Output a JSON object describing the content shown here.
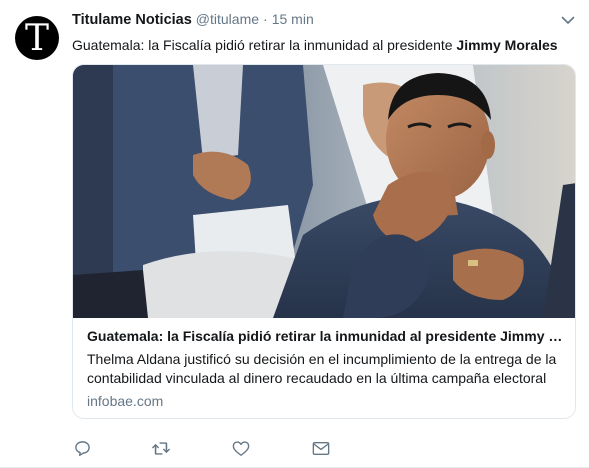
{
  "tweet": {
    "author_name": "Titulame Noticias",
    "author_handle": "@titulame",
    "separator": "·",
    "timestamp": "15 min",
    "avatar_letter": "T",
    "text_plain": "Guatemala: la Fiscalía pidió retirar la inmunidad al presidente ",
    "text_bold": "Jimmy Morales"
  },
  "card": {
    "title": "Guatemala: la Fiscalía pidió retirar la inmunidad al presidente Jimmy Morales",
    "description": "Thelma Aldana justificó su decisión en el incumplimiento de la entrega de la contabilidad vinculada al dinero recaudado en la última campaña electoral",
    "domain": "infobae.com"
  },
  "actions": {
    "icons": [
      "reply-icon",
      "retweet-icon",
      "like-icon",
      "direct-message-icon"
    ]
  },
  "colors": {
    "text": "#14171a",
    "muted": "#657786",
    "border": "#e1e8ed",
    "icon": "#657786"
  }
}
